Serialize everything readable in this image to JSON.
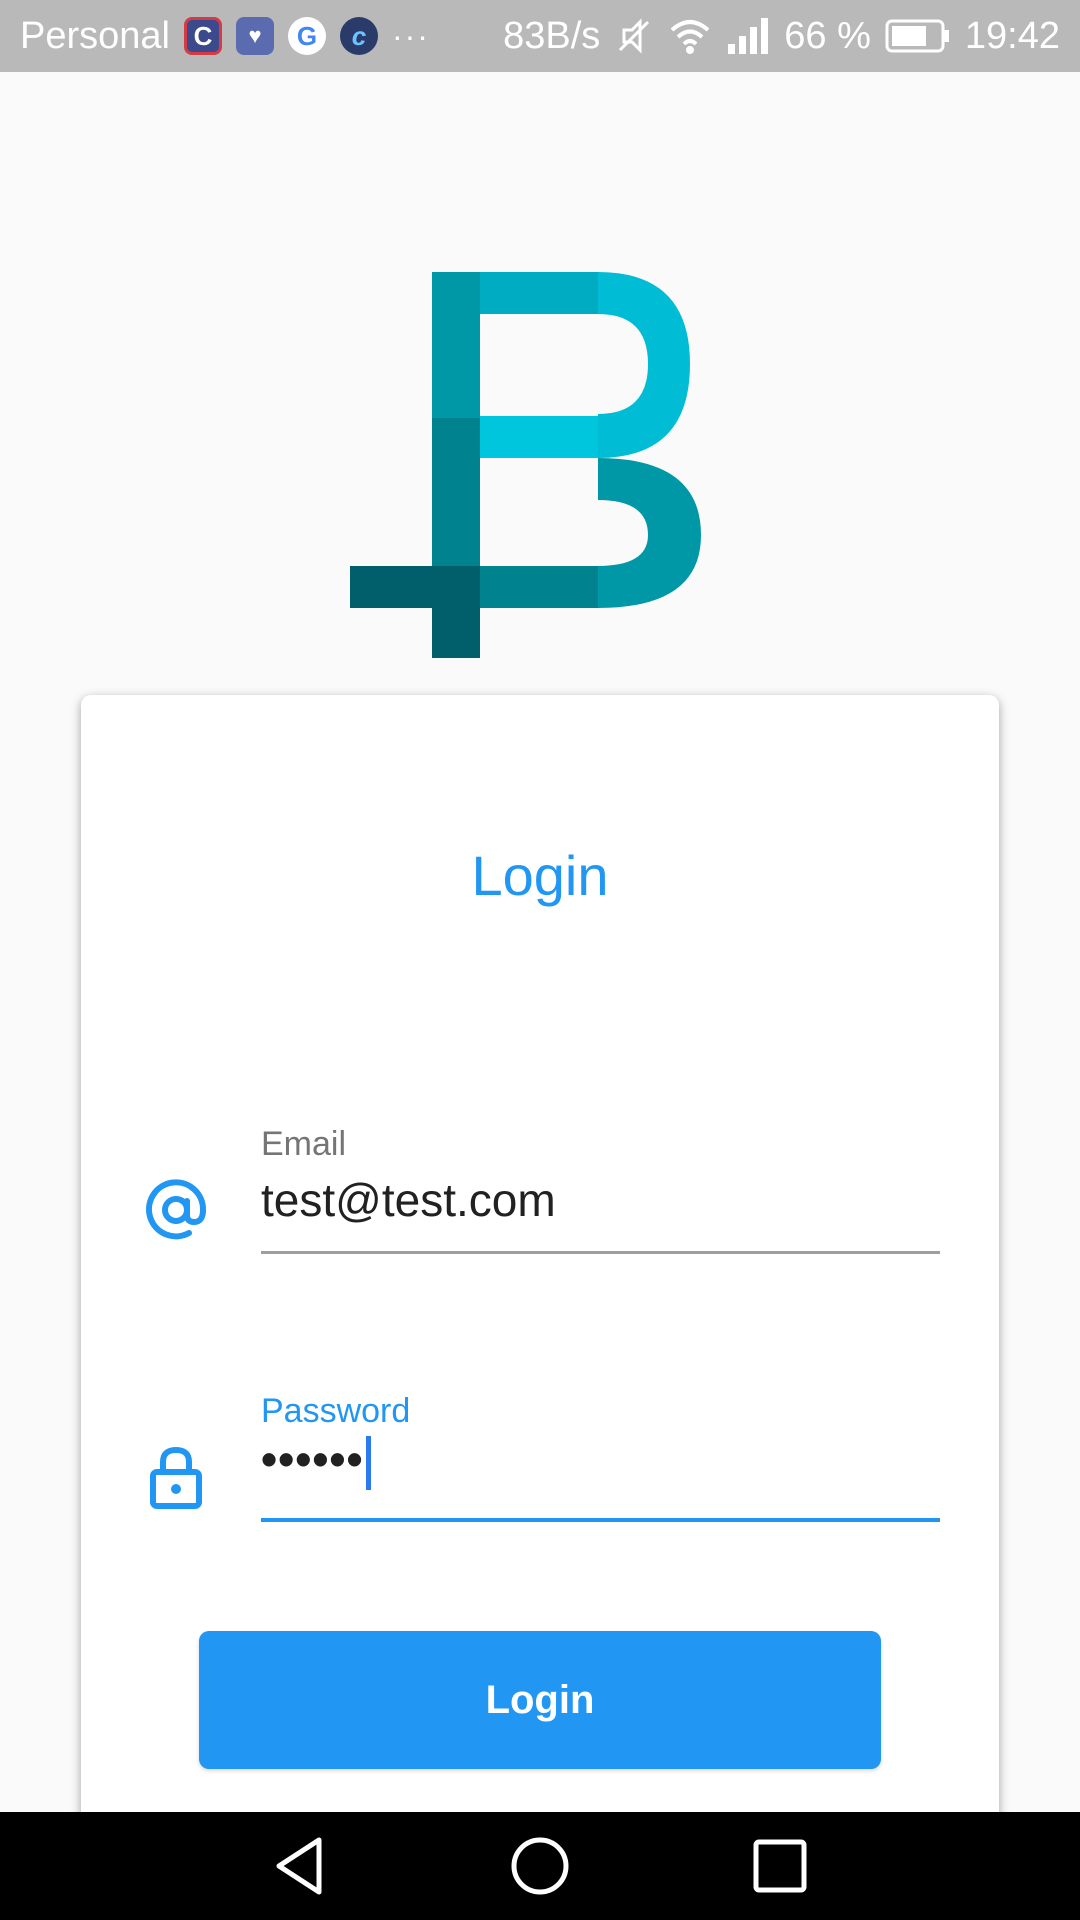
{
  "status_bar": {
    "profile": "Personal",
    "app_icons": [
      "c-app-icon",
      "health-app-icon",
      "google-icon",
      "c-circle-app-icon"
    ],
    "overflow": "···",
    "network_speed": "83B/s",
    "battery": "66 %",
    "time": "19:42"
  },
  "logo": {
    "colors": [
      "#0097a7",
      "#00bcd4",
      "#00838f",
      "#005f6b",
      "#26c6da"
    ]
  },
  "login": {
    "title": "Login",
    "email": {
      "label": "Email",
      "value": "test@test.com"
    },
    "password": {
      "label": "Password",
      "value": "••••••"
    },
    "button": "Login"
  },
  "colors": {
    "accent": "#2196f3",
    "background": "#fafafa"
  }
}
